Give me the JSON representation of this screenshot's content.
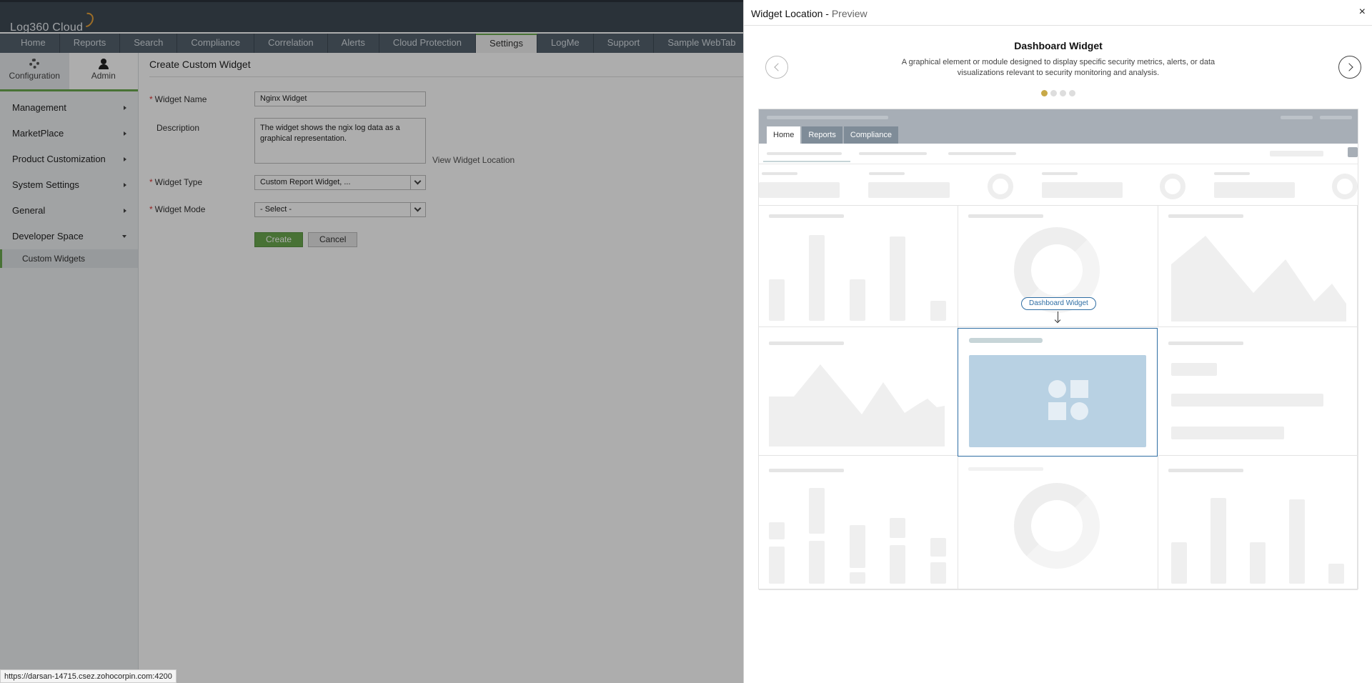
{
  "app": {
    "logo": "Log360 Cloud"
  },
  "tabs": [
    "Home",
    "Reports",
    "Search",
    "Compliance",
    "Correlation",
    "Alerts",
    "Cloud Protection",
    "Settings",
    "LogMe",
    "Support",
    "Sample WebTab"
  ],
  "active_tab": "Settings",
  "sidebar": {
    "switch": [
      {
        "label": "Configuration",
        "icon": "gear-icon"
      },
      {
        "label": "Admin",
        "icon": "user-icon"
      }
    ],
    "items": [
      {
        "label": "Management"
      },
      {
        "label": "MarketPlace"
      },
      {
        "label": "Product Customization"
      },
      {
        "label": "System Settings"
      },
      {
        "label": "General"
      },
      {
        "label": "Developer Space"
      }
    ],
    "sub_item": "Custom Widgets"
  },
  "form": {
    "title": "Create Custom Widget",
    "widget_name_label": "Widget Name",
    "widget_name_value": "Nginx Widget",
    "description_label": "Description",
    "description_value": "The widget shows the ngix log data as a graphical representation.",
    "widget_type_label": "Widget Type",
    "widget_type_value": "Custom Report Widget, ...",
    "view_location_link": "View Widget Location",
    "widget_mode_label": "Widget Mode",
    "widget_mode_value": "- Select -",
    "create_label": "Create",
    "cancel_label": "Cancel"
  },
  "status_url": "https://darsan-14715.csez.zohocorpin.com:4200",
  "panel": {
    "title": "Widget Location - ",
    "subtitle": "Preview",
    "close": "×",
    "carousel_title": "Dashboard Widget",
    "carousel_desc": "A graphical element or module designed to display specific security metrics, alerts, or data visualizations relevant to security monitoring and analysis.",
    "dots_total": 4,
    "dots_active": 1,
    "mock_tabs": [
      "Home",
      "Reports",
      "Compliance"
    ],
    "callout": "Dashboard Widget"
  },
  "colors": {
    "accent": "#6aa84f",
    "highlight": "#2f6ea4",
    "dot_active": "#c8a948"
  }
}
